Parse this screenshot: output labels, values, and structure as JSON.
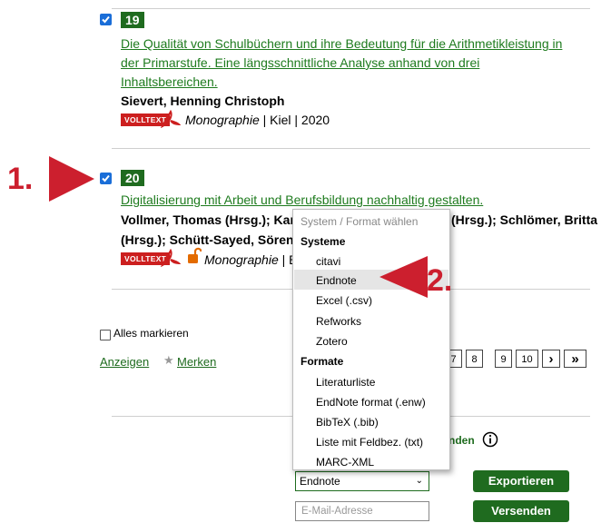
{
  "colors": {
    "accent_green": "#1f6b1f",
    "link_green": "#1e7b1e",
    "fulltext_red": "#cc1f1f",
    "annotation_red": "#cc1f2e",
    "checkbox_blue": "#1a6ed8"
  },
  "records": [
    {
      "number": "19",
      "title_lines": [
        "Die Qualität von Schulbüchern und ihre Bedeutung für die Arithmetikleistung in",
        "der Primarstufe. Eine längsschnittliche Analyse anhand von drei",
        "Inhaltsbereichen."
      ],
      "authors_lines": [
        "Sievert, Henning Christoph"
      ],
      "fulltext_badge": "VOLLTEXT",
      "type": "Monographie",
      "meta_rest": "| Kiel | 2020"
    },
    {
      "number": "20",
      "title_lines": [
        "Digitalisierung mit Arbeit und Berufsbildung nachhaltig gestalten."
      ],
      "authors_lines": [
        "Vollmer, Thomas (Hrsg.); Karges",
        "(Hrsg.); Schütt-Sayed, Sören (Hrs"
      ],
      "authors_right": "(Hrsg.); Schlömer, Britta",
      "fulltext_badge": "VOLLTEXT",
      "type": "Monographie",
      "meta_rest": "| B"
    }
  ],
  "select_all_label": "Alles markieren",
  "links": {
    "show": "Anzeigen",
    "save": "Merken"
  },
  "pagination": [
    "7",
    "8",
    "9",
    "10",
    "›",
    "»"
  ],
  "dropdown": {
    "header": "System / Format wählen",
    "group_systems": "Systeme",
    "systems": [
      "citavi",
      "Endnote",
      "Excel (.csv)",
      "Refworks",
      "Zotero"
    ],
    "group_formats": "Formate",
    "formats": [
      "Literaturliste",
      "EndNote format (.enw)",
      "BibTeX (.bib)",
      "Liste mit Feldbez. (txt)",
      "MARC-XML"
    ]
  },
  "send_label_fragment": "nden",
  "export": {
    "selected": "Endnote",
    "button": "Exportieren"
  },
  "email": {
    "placeholder": "E-Mail-Adresse",
    "button": "Versenden"
  },
  "annotations": {
    "step1": "1.",
    "step2": "2."
  }
}
